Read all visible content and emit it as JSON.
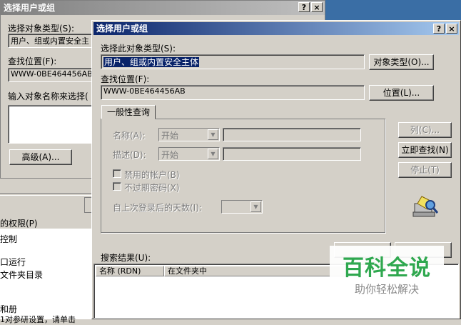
{
  "back_window": {
    "title": "选择用户或组",
    "object_type_label": "选择对象类型(S):",
    "object_type_value": "用户、组或内置安全主",
    "location_label": "查找位置(F):",
    "location_value": "WWW-0BE464456AB",
    "names_label": "输入对象名称来选择(",
    "advanced_button": "高级(A)...",
    "title_help": "?",
    "title_close": "×"
  },
  "left_fragment": {
    "perm_label": "的权限(P)",
    "items": [
      "控制",
      "口运行",
      "文件夹目录",
      "和册"
    ],
    "bottom_text": "1对参研设置，请单击"
  },
  "dialog": {
    "title": "选择用户或组",
    "title_help": "?",
    "title_close": "×",
    "object_type_label": "选择此对象类型(S):",
    "object_type_value": "用户、组或内置安全主体",
    "object_types_button": "对象类型(O)...",
    "location_label": "查找位置(F):",
    "location_value": "WWW-0BE464456AB",
    "location_button": "位置(L)...",
    "tab_label": "一般性查询",
    "name_label": "名称(A):",
    "name_mode": "开始",
    "desc_label": "描述(D):",
    "desc_mode": "开始",
    "disabled_accounts": "禁用的帐户(B)",
    "non_expiring": "不过期密码(X)",
    "days_since_login": "自上次登录后的天数(I):",
    "columns_button": "列(C)...",
    "find_now_button": "立即查找(N)",
    "stop_button": "停止(T)",
    "results_label": "搜索结果(U):",
    "col_name": "名称 (RDN)",
    "col_folder": "在文件夹中"
  },
  "watermark": {
    "title": "百科全说",
    "subtitle": "助你轻松解决"
  },
  "colors": {
    "title_active": "#0a246a",
    "window_bg": "#d4d0c8",
    "watermark_green": "#2fa84f"
  }
}
